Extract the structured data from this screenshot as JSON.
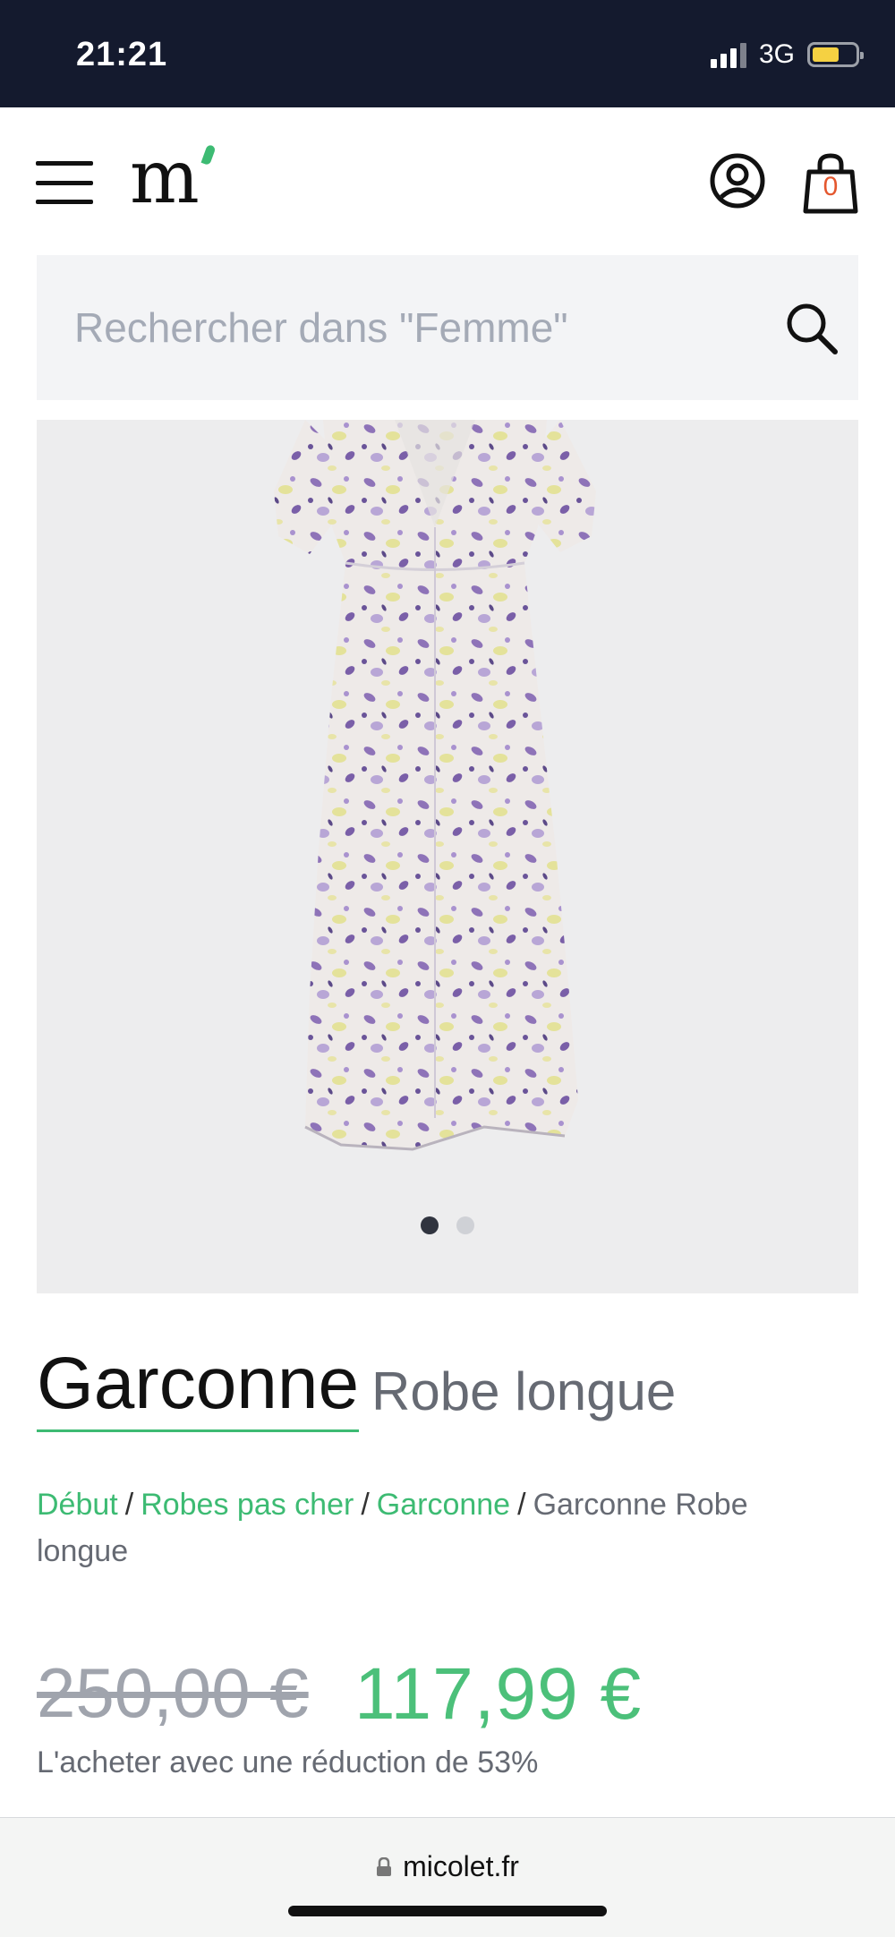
{
  "status_bar": {
    "time": "21:21",
    "network": "3G"
  },
  "header": {
    "logo": "m",
    "cart_count": "0"
  },
  "search": {
    "placeholder": "Rechercher dans \"Femme\""
  },
  "gallery": {
    "image_count": 2,
    "active_index": 0
  },
  "product": {
    "brand": "Garconne",
    "name": "Robe longue"
  },
  "breadcrumb": {
    "items": [
      "Début",
      "Robes pas cher",
      "Garconne"
    ],
    "current": "Garconne Robe longue",
    "separator": "/"
  },
  "price": {
    "old": "250,00 €",
    "new": "117,99 €",
    "discount_text": "L'acheter avec une réduction de 53%"
  },
  "browser": {
    "url": "micolet.fr"
  },
  "colors": {
    "accent_green": "#3dbb73",
    "price_green": "#4cc07a",
    "status_bar_bg": "#141a2e",
    "dress_purple": "#8e73b8",
    "dress_yellow": "#e4e29a"
  },
  "icons": {
    "menu": "menu-icon",
    "account": "user-circle-icon",
    "cart": "shopping-bag-icon",
    "search": "search-icon",
    "lock": "lock-icon"
  }
}
